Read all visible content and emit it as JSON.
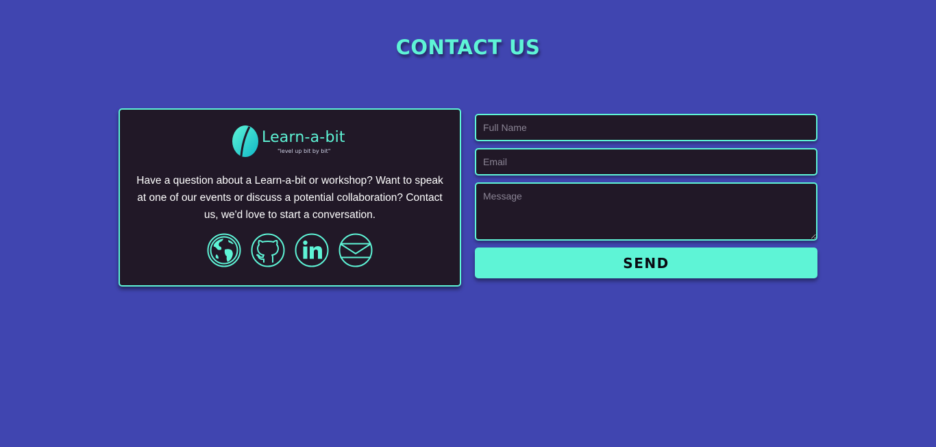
{
  "page": {
    "title": "CONTACT US"
  },
  "colors": {
    "background": "#4045b0",
    "accent": "#5ef4d6",
    "card": "#211827",
    "text": "#ffffff"
  },
  "info_card": {
    "logo": {
      "icon": "leaf-logo-icon",
      "name": "Learn-a-bit",
      "tagline": "\"level up bit by bit\""
    },
    "description": "Have a question about a Learn-a-bit or workshop? Want to speak at one of our events or discuss a potential collaboration? Contact us, we'd love to start a conversation.",
    "socials": [
      {
        "icon": "globe-icon"
      },
      {
        "icon": "github-icon"
      },
      {
        "icon": "linkedin-icon"
      },
      {
        "icon": "mail-icon"
      }
    ]
  },
  "form": {
    "full_name": {
      "placeholder": "Full Name",
      "value": ""
    },
    "email": {
      "placeholder": "Email",
      "value": ""
    },
    "message": {
      "placeholder": "Message",
      "value": ""
    },
    "send_label": "SEND"
  }
}
